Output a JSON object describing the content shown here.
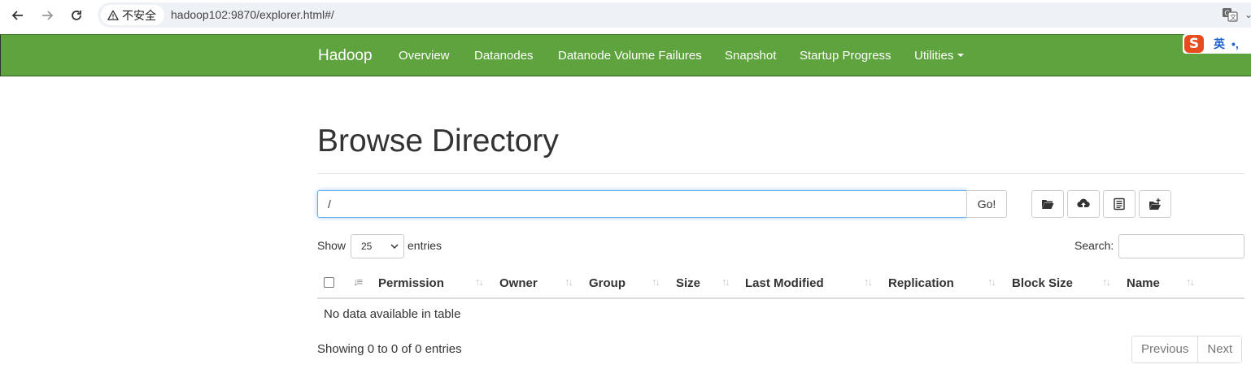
{
  "browser": {
    "security_label": "不安全",
    "url": "hadoop102:9870/explorer.html#/"
  },
  "navbar": {
    "brand": "Hadoop",
    "items": [
      {
        "label": "Overview"
      },
      {
        "label": "Datanodes"
      },
      {
        "label": "Datanode Volume Failures"
      },
      {
        "label": "Snapshot"
      },
      {
        "label": "Startup Progress"
      },
      {
        "label": "Utilities"
      }
    ],
    "color": "#5fa33e"
  },
  "ime": {
    "logo": "S",
    "mode": "英",
    "punct": "•,"
  },
  "page": {
    "title": "Browse Directory",
    "path_value": "/",
    "go_label": "Go!",
    "toolbar_icons": [
      "folder-open-icon",
      "cloud-upload-icon",
      "list-alt-icon",
      "folder-plus-icon"
    ]
  },
  "table_controls": {
    "show_label": "Show",
    "entries_value": "25",
    "entries_label": "entries",
    "search_label": "Search:"
  },
  "table": {
    "columns": [
      "Permission",
      "Owner",
      "Group",
      "Size",
      "Last Modified",
      "Replication",
      "Block Size",
      "Name"
    ],
    "empty_message": "No data available in table"
  },
  "footer": {
    "info": "Showing 0 to 0 of 0 entries",
    "previous_label": "Previous",
    "next_label": "Next"
  }
}
